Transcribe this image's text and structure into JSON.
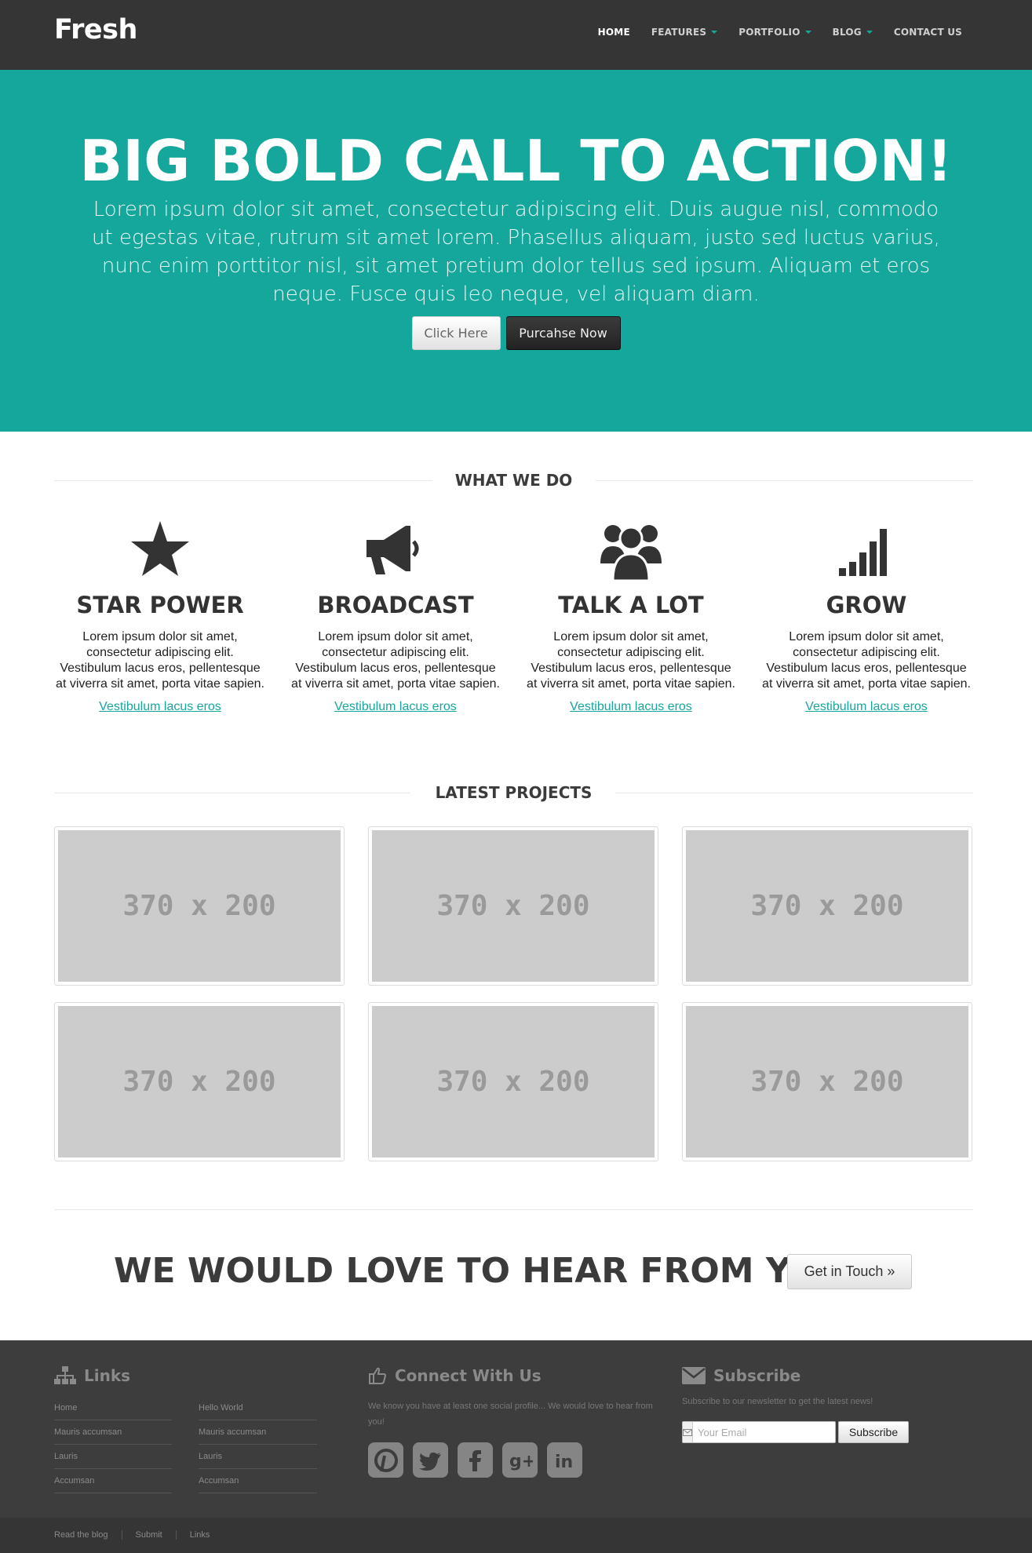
{
  "navbar": {
    "brand": "Fresh",
    "items": [
      {
        "label": "HOME",
        "active": true,
        "dropdown": false
      },
      {
        "label": "FEATURES",
        "active": false,
        "dropdown": true
      },
      {
        "label": "PORTFOLIO",
        "active": false,
        "dropdown": true
      },
      {
        "label": "BLOG",
        "active": false,
        "dropdown": true
      },
      {
        "label": "CONTACT US",
        "active": false,
        "dropdown": false
      }
    ]
  },
  "hero": {
    "title": "BIG BOLD CALL TO ACTION!",
    "text": "Lorem ipsum dolor sit amet, consectetur adipiscing elit. Duis augue nisl, commodo ut egestas vitae, rutrum sit amet lorem. Phasellus aliquam, justo sed luctus varius, nunc enim porttitor nisl, sit amet pretium dolor tellus sed ipsum. Aliquam et eros neque. Fusce quis leo neque, vel aliquam diam.",
    "button_primary": "Click Here",
    "button_secondary": "Purcahse Now",
    "background_color": "#16a79c"
  },
  "what_we_do": {
    "heading": "WHAT WE DO",
    "features": [
      {
        "icon": "star-icon",
        "title": "STAR POWER",
        "text": "Lorem ipsum dolor sit amet, consectetur adipiscing elit. Vestibulum lacus eros, pellentesque at viverra sit amet, porta vitae sapien.",
        "link": "Vestibulum lacus eros"
      },
      {
        "icon": "megaphone-icon",
        "title": "BROADCAST",
        "text": "Lorem ipsum dolor sit amet, consectetur adipiscing elit. Vestibulum lacus eros, pellentesque at viverra sit amet, porta vitae sapien.",
        "link": "Vestibulum lacus eros"
      },
      {
        "icon": "group-icon",
        "title": "TALK A LOT",
        "text": "Lorem ipsum dolor sit amet, consectetur adipiscing elit. Vestibulum lacus eros, pellentesque at viverra sit amet, porta vitae sapien.",
        "link": "Vestibulum lacus eros"
      },
      {
        "icon": "signal-bars-icon",
        "title": "GROW",
        "text": "Lorem ipsum dolor sit amet, consectetur adipiscing elit. Vestibulum lacus eros, pellentesque at viverra sit amet, porta vitae sapien.",
        "link": "Vestibulum lacus eros"
      }
    ]
  },
  "latest_projects": {
    "heading": "LATEST PROJECTS",
    "items": [
      {
        "placeholder": "370 x 200"
      },
      {
        "placeholder": "370 x 200"
      },
      {
        "placeholder": "370 x 200"
      },
      {
        "placeholder": "370 x 200"
      },
      {
        "placeholder": "370 x 200"
      },
      {
        "placeholder": "370 x 200"
      }
    ]
  },
  "cta": {
    "title": "WE WOULD LOVE TO HEAR FROM YOU",
    "button": "Get in Touch »"
  },
  "footer": {
    "links": {
      "title": "Links",
      "icon": "sitemap-icon",
      "col1": [
        "Home",
        "Mauris accumsan",
        "Lauris",
        "Accumsan"
      ],
      "col2": [
        "Hello World",
        "Mauris accumsan",
        "Lauris",
        "Accumsan"
      ]
    },
    "connect": {
      "title": "Connect With Us",
      "icon": "thumbs-up-icon",
      "text": "We know you have at least one social profile... We would love to hear from you!",
      "socials": [
        "pinterest-icon",
        "twitter-icon",
        "facebook-icon",
        "google-plus-icon",
        "linkedin-icon"
      ]
    },
    "subscribe": {
      "title": "Subscribe",
      "icon": "envelope-icon",
      "text": "Subscribe to our newsletter to get the latest news!",
      "placeholder": "Your Email",
      "button": "Subscribe"
    },
    "bottom_links": [
      "Read the blog",
      "Submit",
      "Links"
    ]
  },
  "colors": {
    "accent": "#16a79c",
    "navbar": "#353535",
    "footer": "#3d3d3d"
  }
}
